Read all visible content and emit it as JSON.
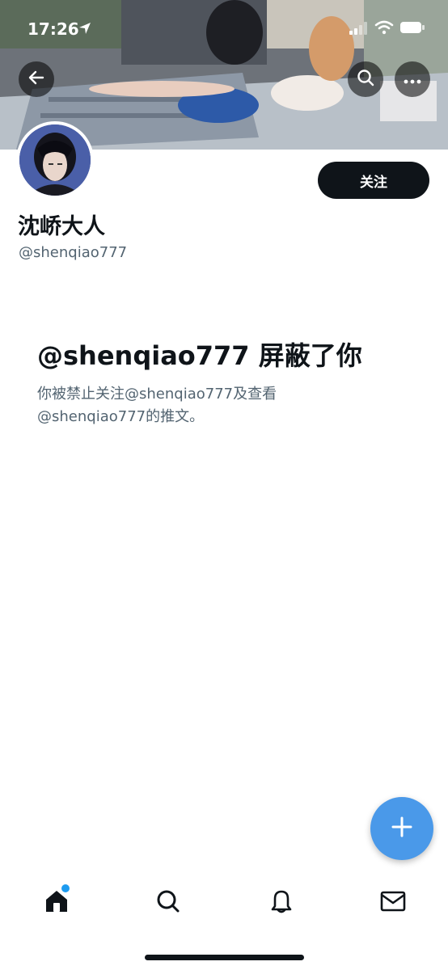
{
  "status_bar": {
    "time": "17:26",
    "icons": [
      "location-arrow-icon",
      "signal-icon",
      "wifi-icon",
      "battery-icon"
    ]
  },
  "header": {
    "back_icon": "back-arrow-icon",
    "search_icon": "search-icon",
    "more_icon": "more-icon"
  },
  "profile": {
    "display_name": "沈峤大人",
    "handle": "@shenqiao777",
    "follow_label": "关注"
  },
  "blocked": {
    "title": "@shenqiao777 屏蔽了你",
    "description": "你被禁止关注@shenqiao777及查看@shenqiao777的推文。"
  },
  "fab": {
    "icon": "plus-icon"
  },
  "bottom_nav": {
    "items": [
      "home-icon",
      "search-icon",
      "bell-icon",
      "mail-icon"
    ],
    "home_has_notification": true
  },
  "colors": {
    "primary_text": "#0f1419",
    "secondary_text": "#536471",
    "accent": "#1d9bf0",
    "fab": "#4a99e9"
  }
}
